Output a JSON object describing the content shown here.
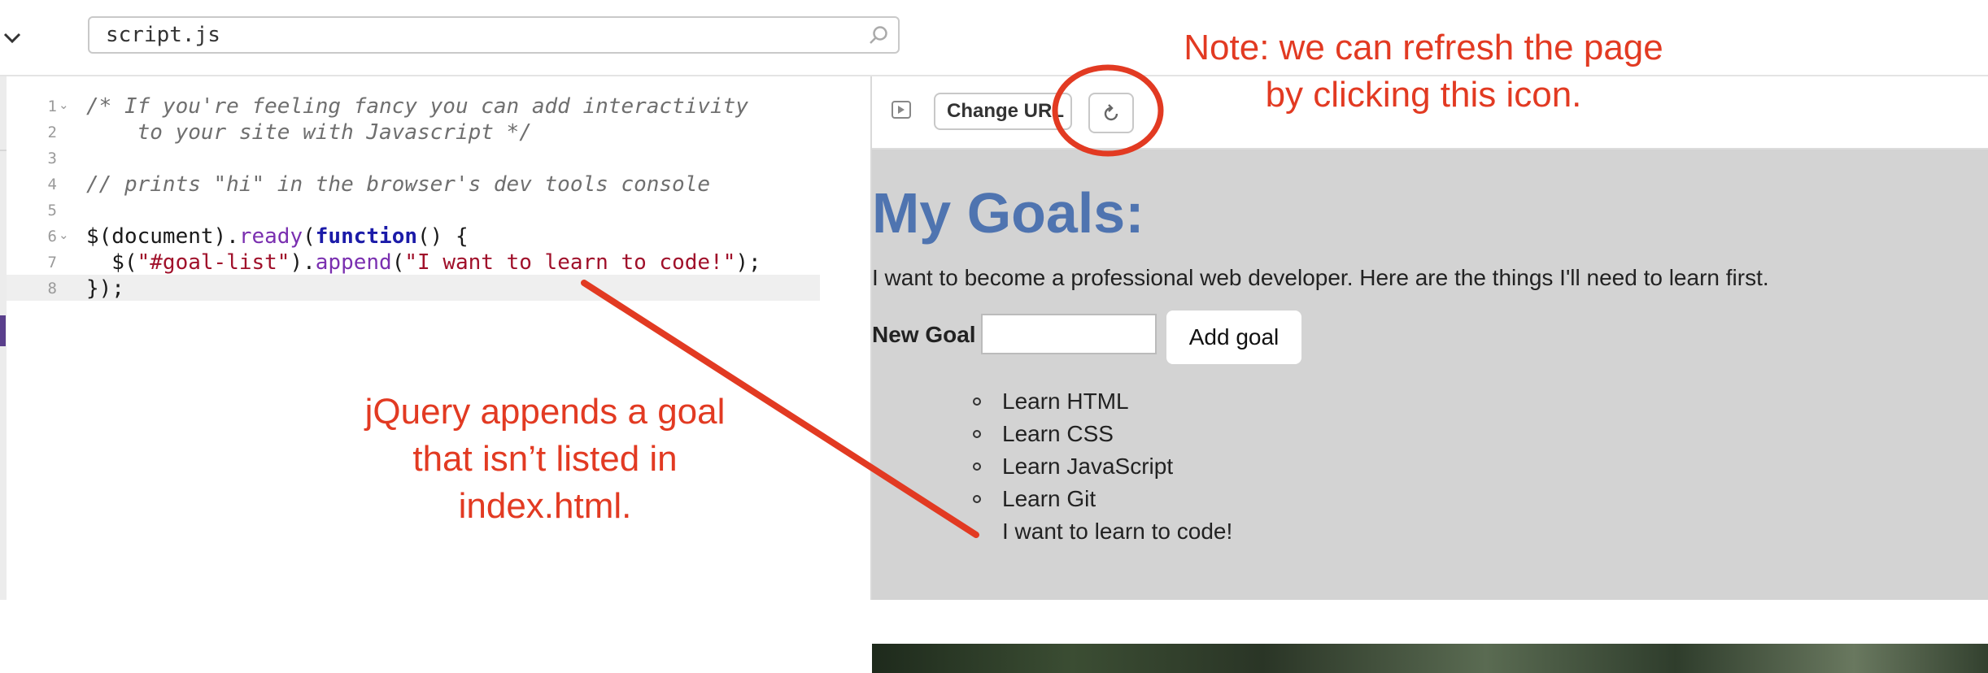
{
  "topbar": {
    "file_search_value": "script.js"
  },
  "editor": {
    "lines": [
      {
        "num": "1"
      },
      {
        "num": "2"
      },
      {
        "num": "3"
      },
      {
        "num": "4"
      },
      {
        "num": "5"
      },
      {
        "num": "6"
      },
      {
        "num": "7"
      },
      {
        "num": "8"
      }
    ],
    "code": {
      "l1": "/* If you're feeling fancy you can add interactivity",
      "l2": "    to your site with Javascript */",
      "l4": "// prints \"hi\" in the browser's dev tools console",
      "l6_a": "$(document).",
      "l6_b": "ready",
      "l6_c": "(",
      "l6_d": "function",
      "l6_e": "() {",
      "l7_a": "  $(",
      "l7_b": "\"#goal-list\"",
      "l7_c": ").",
      "l7_d": "append",
      "l7_e": "(",
      "l7_f": "\"I want to learn to code!\"",
      "l7_g": ");",
      "l8": "});"
    }
  },
  "preview": {
    "change_url_label": "Change URL",
    "page": {
      "title": "My Goals:",
      "description": "I want to become a professional web developer. Here are the things I'll need to learn first.",
      "new_goal_label": "New Goal",
      "add_goal_label": "Add goal",
      "goals": [
        "Learn HTML",
        "Learn CSS",
        "Learn JavaScript",
        "Learn Git",
        "I want to learn to code!"
      ]
    }
  },
  "annotations": {
    "refresh_note_line1": "Note: we can refresh the page",
    "refresh_note_line2": "by clicking this icon.",
    "jquery_note_line1": "jQuery appends a goal",
    "jquery_note_line2": "that isn’t listed in",
    "jquery_note_line3": "index.html.",
    "color": "#e23a22"
  },
  "colors": {
    "title_blue": "#4f74b0",
    "page_bg": "#d3d3d3",
    "accent_purple": "#5a3f8c"
  },
  "icons": [
    "chevron-down-icon",
    "search-icon",
    "play-icon",
    "refresh-icon",
    "fold-chevron-icon",
    "bullet-icon"
  ]
}
